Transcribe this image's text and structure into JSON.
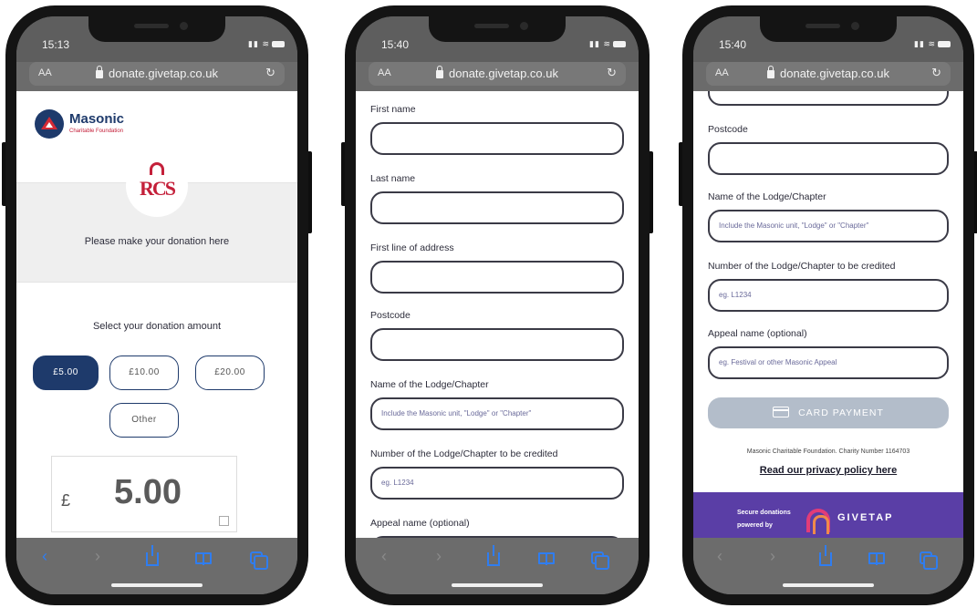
{
  "status": {
    "phone1_time": "15:13",
    "phone2_time": "15:40",
    "phone3_time": "15:40"
  },
  "browser": {
    "url": "donate.givetap.co.uk",
    "text_size_label": "AA",
    "reload_icon": "reload-icon"
  },
  "donation_page": {
    "brand_name": "Masonic",
    "brand_subtitle": "Charitable Foundation",
    "rcs_logo_text": "RCS",
    "intro": "Please make your donation here",
    "select_label": "Select your donation amount",
    "amounts": [
      "£5.00",
      "£10.00",
      "£20.00",
      "Other"
    ],
    "selected_amount": "£5.00",
    "currency_symbol": "£",
    "amount_value": "5.00"
  },
  "form": {
    "first_name_label": "First name",
    "last_name_label": "Last name",
    "address_label": "First line of address",
    "postcode_label": "Postcode",
    "lodge_label": "Name of the Lodge/Chapter",
    "lodge_placeholder": "Include the Masonic unit, \"Lodge\" or \"Chapter\"",
    "lodge_number_label": "Number of the Lodge/Chapter to be credited",
    "lodge_number_placeholder": "eg. L1234",
    "appeal_label": "Appeal name (optional)",
    "appeal_placeholder": "eg. Festival or other Masonic Appeal"
  },
  "payment": {
    "card_button_label": "CARD PAYMENT",
    "charity_text": "Masonic Charitable Foundation. Charity Number 1164703",
    "privacy_link": "Read our privacy policy here",
    "secure_line1": "Secure donations",
    "secure_line2": "powered by",
    "givetap_name": "GIVETAP"
  },
  "colors": {
    "navy": "#1e3a6b",
    "brand_red": "#c4203a",
    "givetap_purple": "#5a3ea6",
    "safari_blue": "#2f7df0"
  }
}
